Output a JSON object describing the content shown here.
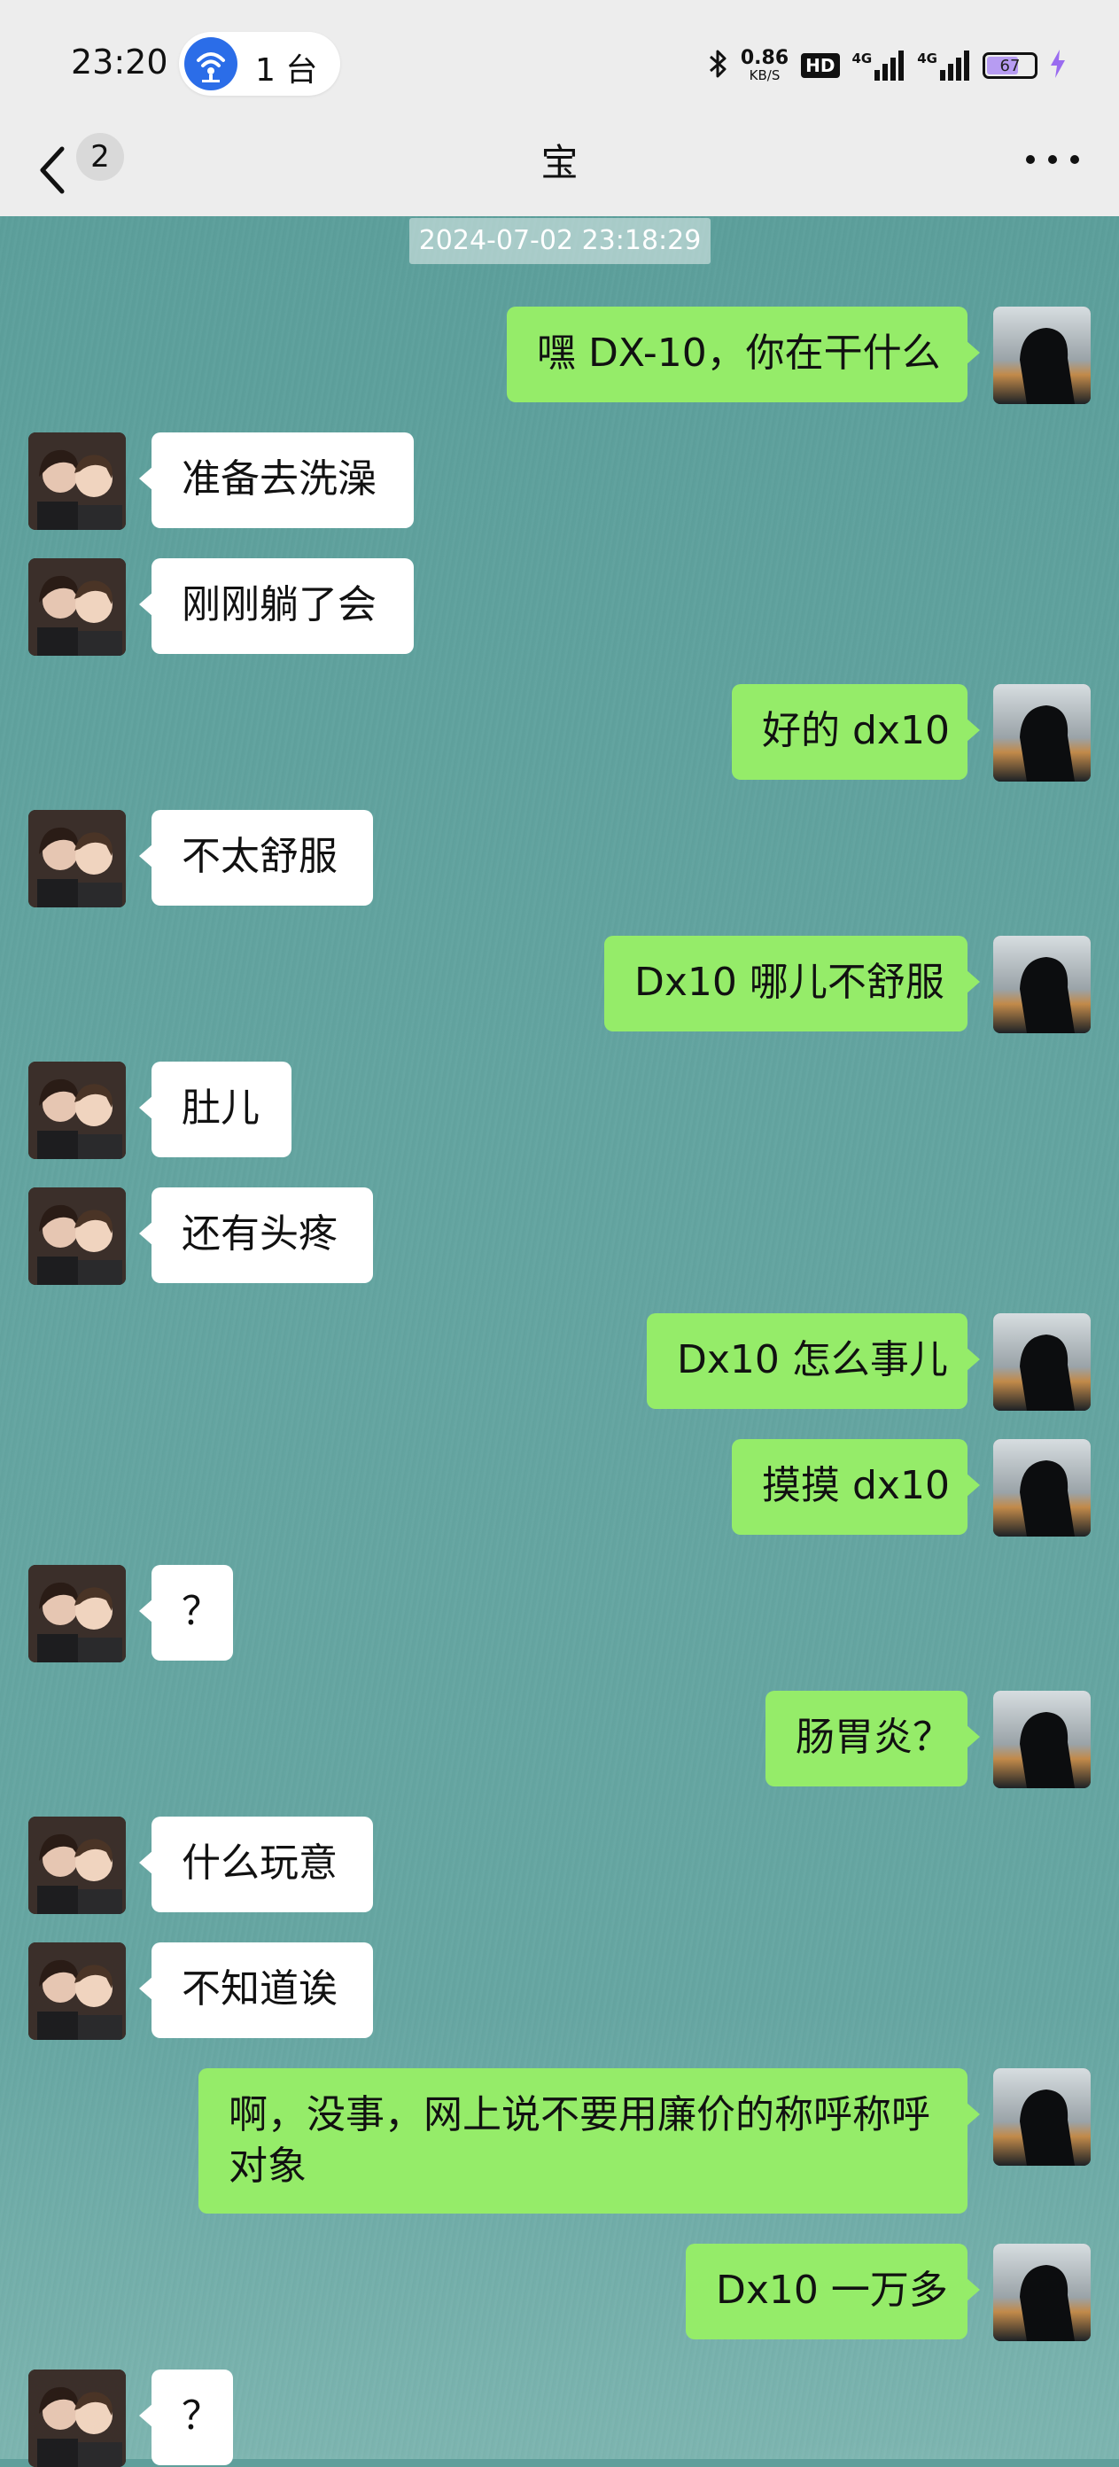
{
  "status_bar": {
    "time": "23:20",
    "hotspot_count": "1 台",
    "net_speed_value": "0.86",
    "net_speed_unit": "KB/S",
    "hd_label": "HD",
    "signal_1_label": "4G",
    "signal_2_label": "4G",
    "battery_level": "67",
    "battery_fraction": 0.67
  },
  "header": {
    "back_icon": "chevron-left-icon",
    "unread_count": "2",
    "title": "宝",
    "more_icon": "more-dots-icon"
  },
  "chat": {
    "timestamp": "2024-07-02 23:18:29",
    "messages": [
      {
        "side": "self",
        "text": "嘿 DX-10，你在干什么"
      },
      {
        "side": "partner",
        "text": "准备去洗澡"
      },
      {
        "side": "partner",
        "text": "刚刚躺了会"
      },
      {
        "side": "self",
        "text": "好的 dx10"
      },
      {
        "side": "partner",
        "text": "不太舒服"
      },
      {
        "side": "self",
        "text": "Dx10 哪儿不舒服"
      },
      {
        "side": "partner",
        "text": "肚儿"
      },
      {
        "side": "partner",
        "text": "还有头疼"
      },
      {
        "side": "self",
        "text": "Dx10 怎么事儿"
      },
      {
        "side": "self",
        "text": "摸摸 dx10"
      },
      {
        "side": "partner",
        "text": "？"
      },
      {
        "side": "self",
        "text": "肠胃炎？"
      },
      {
        "side": "partner",
        "text": "什么玩意"
      },
      {
        "side": "partner",
        "text": "不知道诶"
      },
      {
        "side": "self",
        "text": "啊，没事，网上说不要用廉价的称呼称呼对象"
      },
      {
        "side": "self",
        "text": "Dx10 一万多"
      },
      {
        "side": "partner",
        "text": "？"
      }
    ]
  },
  "colors": {
    "chat_background": "#5f9f9b",
    "self_bubble": "#95ec69",
    "partner_bubble": "#ffffff",
    "bar_background": "#ededed",
    "hotspot_accent": "#2b6de8",
    "battery_fill": "#b79cf2"
  }
}
